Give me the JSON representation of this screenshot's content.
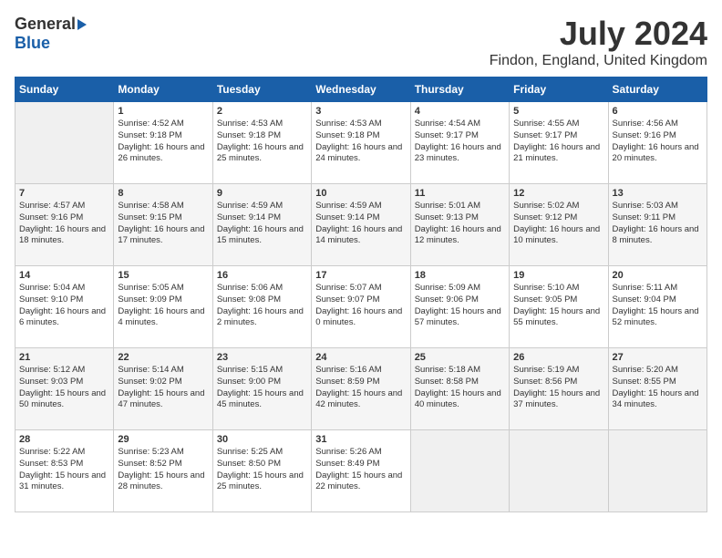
{
  "logo": {
    "general": "General",
    "blue": "Blue"
  },
  "title": "July 2024",
  "location": "Findon, England, United Kingdom",
  "days_of_week": [
    "Sunday",
    "Monday",
    "Tuesday",
    "Wednesday",
    "Thursday",
    "Friday",
    "Saturday"
  ],
  "weeks": [
    [
      {
        "day": "",
        "sunrise": "",
        "sunset": "",
        "daylight": ""
      },
      {
        "day": "1",
        "sunrise": "Sunrise: 4:52 AM",
        "sunset": "Sunset: 9:18 PM",
        "daylight": "Daylight: 16 hours and 26 minutes."
      },
      {
        "day": "2",
        "sunrise": "Sunrise: 4:53 AM",
        "sunset": "Sunset: 9:18 PM",
        "daylight": "Daylight: 16 hours and 25 minutes."
      },
      {
        "day": "3",
        "sunrise": "Sunrise: 4:53 AM",
        "sunset": "Sunset: 9:18 PM",
        "daylight": "Daylight: 16 hours and 24 minutes."
      },
      {
        "day": "4",
        "sunrise": "Sunrise: 4:54 AM",
        "sunset": "Sunset: 9:17 PM",
        "daylight": "Daylight: 16 hours and 23 minutes."
      },
      {
        "day": "5",
        "sunrise": "Sunrise: 4:55 AM",
        "sunset": "Sunset: 9:17 PM",
        "daylight": "Daylight: 16 hours and 21 minutes."
      },
      {
        "day": "6",
        "sunrise": "Sunrise: 4:56 AM",
        "sunset": "Sunset: 9:16 PM",
        "daylight": "Daylight: 16 hours and 20 minutes."
      }
    ],
    [
      {
        "day": "7",
        "sunrise": "Sunrise: 4:57 AM",
        "sunset": "Sunset: 9:16 PM",
        "daylight": "Daylight: 16 hours and 18 minutes."
      },
      {
        "day": "8",
        "sunrise": "Sunrise: 4:58 AM",
        "sunset": "Sunset: 9:15 PM",
        "daylight": "Daylight: 16 hours and 17 minutes."
      },
      {
        "day": "9",
        "sunrise": "Sunrise: 4:59 AM",
        "sunset": "Sunset: 9:14 PM",
        "daylight": "Daylight: 16 hours and 15 minutes."
      },
      {
        "day": "10",
        "sunrise": "Sunrise: 4:59 AM",
        "sunset": "Sunset: 9:14 PM",
        "daylight": "Daylight: 16 hours and 14 minutes."
      },
      {
        "day": "11",
        "sunrise": "Sunrise: 5:01 AM",
        "sunset": "Sunset: 9:13 PM",
        "daylight": "Daylight: 16 hours and 12 minutes."
      },
      {
        "day": "12",
        "sunrise": "Sunrise: 5:02 AM",
        "sunset": "Sunset: 9:12 PM",
        "daylight": "Daylight: 16 hours and 10 minutes."
      },
      {
        "day": "13",
        "sunrise": "Sunrise: 5:03 AM",
        "sunset": "Sunset: 9:11 PM",
        "daylight": "Daylight: 16 hours and 8 minutes."
      }
    ],
    [
      {
        "day": "14",
        "sunrise": "Sunrise: 5:04 AM",
        "sunset": "Sunset: 9:10 PM",
        "daylight": "Daylight: 16 hours and 6 minutes."
      },
      {
        "day": "15",
        "sunrise": "Sunrise: 5:05 AM",
        "sunset": "Sunset: 9:09 PM",
        "daylight": "Daylight: 16 hours and 4 minutes."
      },
      {
        "day": "16",
        "sunrise": "Sunrise: 5:06 AM",
        "sunset": "Sunset: 9:08 PM",
        "daylight": "Daylight: 16 hours and 2 minutes."
      },
      {
        "day": "17",
        "sunrise": "Sunrise: 5:07 AM",
        "sunset": "Sunset: 9:07 PM",
        "daylight": "Daylight: 16 hours and 0 minutes."
      },
      {
        "day": "18",
        "sunrise": "Sunrise: 5:09 AM",
        "sunset": "Sunset: 9:06 PM",
        "daylight": "Daylight: 15 hours and 57 minutes."
      },
      {
        "day": "19",
        "sunrise": "Sunrise: 5:10 AM",
        "sunset": "Sunset: 9:05 PM",
        "daylight": "Daylight: 15 hours and 55 minutes."
      },
      {
        "day": "20",
        "sunrise": "Sunrise: 5:11 AM",
        "sunset": "Sunset: 9:04 PM",
        "daylight": "Daylight: 15 hours and 52 minutes."
      }
    ],
    [
      {
        "day": "21",
        "sunrise": "Sunrise: 5:12 AM",
        "sunset": "Sunset: 9:03 PM",
        "daylight": "Daylight: 15 hours and 50 minutes."
      },
      {
        "day": "22",
        "sunrise": "Sunrise: 5:14 AM",
        "sunset": "Sunset: 9:02 PM",
        "daylight": "Daylight: 15 hours and 47 minutes."
      },
      {
        "day": "23",
        "sunrise": "Sunrise: 5:15 AM",
        "sunset": "Sunset: 9:00 PM",
        "daylight": "Daylight: 15 hours and 45 minutes."
      },
      {
        "day": "24",
        "sunrise": "Sunrise: 5:16 AM",
        "sunset": "Sunset: 8:59 PM",
        "daylight": "Daylight: 15 hours and 42 minutes."
      },
      {
        "day": "25",
        "sunrise": "Sunrise: 5:18 AM",
        "sunset": "Sunset: 8:58 PM",
        "daylight": "Daylight: 15 hours and 40 minutes."
      },
      {
        "day": "26",
        "sunrise": "Sunrise: 5:19 AM",
        "sunset": "Sunset: 8:56 PM",
        "daylight": "Daylight: 15 hours and 37 minutes."
      },
      {
        "day": "27",
        "sunrise": "Sunrise: 5:20 AM",
        "sunset": "Sunset: 8:55 PM",
        "daylight": "Daylight: 15 hours and 34 minutes."
      }
    ],
    [
      {
        "day": "28",
        "sunrise": "Sunrise: 5:22 AM",
        "sunset": "Sunset: 8:53 PM",
        "daylight": "Daylight: 15 hours and 31 minutes."
      },
      {
        "day": "29",
        "sunrise": "Sunrise: 5:23 AM",
        "sunset": "Sunset: 8:52 PM",
        "daylight": "Daylight: 15 hours and 28 minutes."
      },
      {
        "day": "30",
        "sunrise": "Sunrise: 5:25 AM",
        "sunset": "Sunset: 8:50 PM",
        "daylight": "Daylight: 15 hours and 25 minutes."
      },
      {
        "day": "31",
        "sunrise": "Sunrise: 5:26 AM",
        "sunset": "Sunset: 8:49 PM",
        "daylight": "Daylight: 15 hours and 22 minutes."
      },
      {
        "day": "",
        "sunrise": "",
        "sunset": "",
        "daylight": ""
      },
      {
        "day": "",
        "sunrise": "",
        "sunset": "",
        "daylight": ""
      },
      {
        "day": "",
        "sunrise": "",
        "sunset": "",
        "daylight": ""
      }
    ]
  ]
}
